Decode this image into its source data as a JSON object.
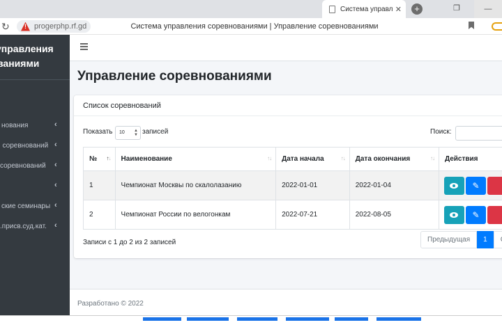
{
  "browser": {
    "tab_title": "Система управлени",
    "tab_close": "✕",
    "new_tab": "+",
    "url": "progerphp.rf.gd",
    "page_title": "Система управления соревнованиями | Управление соревнованиями",
    "reload_icon": "reload-icon",
    "warning_icon": "not-secure-icon"
  },
  "sidebar": {
    "brand_line1": "управления",
    "brand_line2": "ваниями",
    "items": [
      {
        "label": "нования"
      },
      {
        "label": ". соревнований"
      },
      {
        "label": "соревнований"
      },
      {
        "label": ""
      },
      {
        "label": "ские семинары"
      },
      {
        "label": ".присв.суд.кат."
      }
    ],
    "chevron": "‹"
  },
  "main": {
    "title": "Управление соревнованиями",
    "card_title": "Список соревнований",
    "length_label": "Показать",
    "length_value": "10",
    "length_suffix": "записей",
    "search_label": "Поиск:",
    "search_value": "",
    "columns": [
      "№",
      "Наименование",
      "Дата начала",
      "Дата окончания",
      "Действия"
    ],
    "rows": [
      {
        "num": "1",
        "name": "Чемпионат Москвы по скалолазанию",
        "start": "2022-01-01",
        "end": "2022-01-04"
      },
      {
        "num": "2",
        "name": "Чемпионат России по велогонкам",
        "start": "2022-07-21",
        "end": "2022-08-05"
      }
    ],
    "info": "Записи с 1 до 2 из 2 записей",
    "pager": {
      "prev": "Предыдущая",
      "current": "1",
      "next": "Сле"
    },
    "footer": "Разработано © 2022"
  },
  "colors": {
    "sidebar_bg": "#343a40",
    "primary": "#007bff",
    "info": "#17a2b8",
    "danger": "#dc3545",
    "content_bg": "#f4f6f9"
  }
}
